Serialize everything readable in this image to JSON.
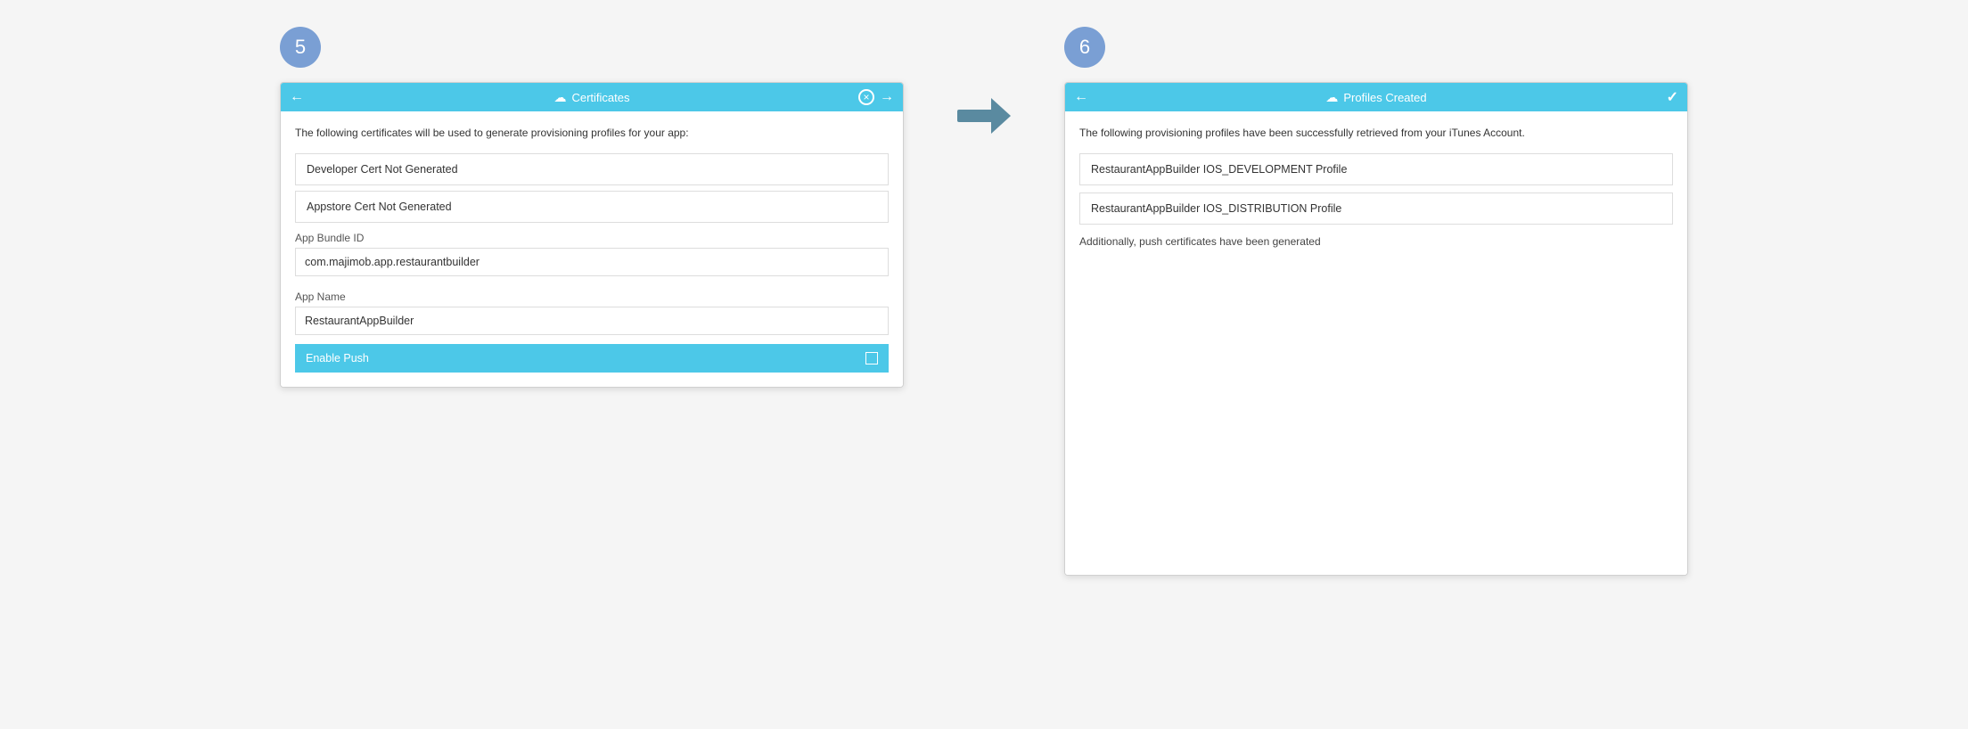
{
  "step5": {
    "badge": "5",
    "window": {
      "titlebar": {
        "back_arrow": "←",
        "cloud_icon": "☁",
        "title": "Certificates",
        "close_icon": "×",
        "forward_arrow": "→"
      },
      "description": "The following certificates will be used to generate provisioning profiles for your app:",
      "cert_items": [
        {
          "label": "Developer Cert Not Generated"
        },
        {
          "label": "Appstore Cert Not Generated"
        }
      ],
      "bundle_id_label": "App Bundle ID",
      "bundle_id_value": "com.majimob.app.restaurantbuilder",
      "app_name_label": "App Name",
      "app_name_value": "RestaurantAppBuilder",
      "enable_push_label": "Enable Push"
    }
  },
  "step6": {
    "badge": "6",
    "window": {
      "titlebar": {
        "back_arrow": "←",
        "cloud_icon": "☁",
        "title": "Profiles Created",
        "check_icon": "✓"
      },
      "description": "The following provisioning profiles have been successfully retrieved from your iTunes Account.",
      "profiles": [
        {
          "label": "RestaurantAppBuilder IOS_DEVELOPMENT Profile"
        },
        {
          "label": "RestaurantAppBuilder IOS_DISTRIBUTION Profile"
        }
      ],
      "additionally_text": "Additionally, push certificates have been generated"
    }
  }
}
